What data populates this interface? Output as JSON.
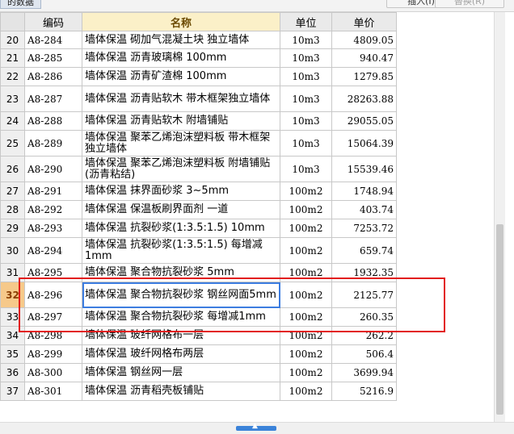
{
  "header": {
    "tab_label": "的数据",
    "btn_insert": "插入(I)",
    "btn_replace": "替换(R)"
  },
  "columns": {
    "index": "",
    "code": "编码",
    "name": "名称",
    "unit": "单位",
    "price": "单价"
  },
  "rows": [
    {
      "n": "20",
      "code": "A8-284",
      "name": "墙体保温 砌加气混凝土块 独立墙体",
      "unit": "10m3",
      "price": "4809.05"
    },
    {
      "n": "21",
      "code": "A8-285",
      "name": "墙体保温 沥青玻璃棉 100mm",
      "unit": "10m3",
      "price": "940.47"
    },
    {
      "n": "22",
      "code": "A8-286",
      "name": "墙体保温 沥青矿渣棉 100mm",
      "unit": "10m3",
      "price": "1279.85"
    },
    {
      "n": "23",
      "code": "A8-287",
      "name": "墙体保温 沥青贴软木 带木框架独立墙体",
      "unit": "10m3",
      "price": "28263.88"
    },
    {
      "n": "24",
      "code": "A8-288",
      "name": "墙体保温 沥青贴软木 附墙铺贴",
      "unit": "10m3",
      "price": "29055.05"
    },
    {
      "n": "25",
      "code": "A8-289",
      "name": "墙体保温 聚苯乙烯泡沫塑料板 带木框架独立墙体",
      "unit": "10m3",
      "price": "15064.39"
    },
    {
      "n": "26",
      "code": "A8-290",
      "name": "墙体保温 聚苯乙烯泡沫塑料板 附墙铺贴(沥青粘结)",
      "unit": "10m3",
      "price": "15539.46"
    },
    {
      "n": "27",
      "code": "A8-291",
      "name": "墙体保温 抹界面砂浆 3~5mm",
      "unit": "100m2",
      "price": "1748.94"
    },
    {
      "n": "28",
      "code": "A8-292",
      "name": "墙体保温 保温板刷界面剂 一道",
      "unit": "100m2",
      "price": "403.74"
    },
    {
      "n": "29",
      "code": "A8-293",
      "name": "墙体保温 抗裂砂浆(1:3.5:1.5) 10mm",
      "unit": "100m2",
      "price": "7253.72"
    },
    {
      "n": "30",
      "code": "A8-294",
      "name": "墙体保温 抗裂砂浆(1:3.5:1.5) 每增减1mm",
      "unit": "100m2",
      "price": "659.74"
    },
    {
      "n": "31",
      "code": "A8-295",
      "name": "墙体保温 聚合物抗裂砂浆 5mm",
      "unit": "100m2",
      "price": "1932.35"
    },
    {
      "n": "32",
      "code": "A8-296",
      "name": "墙体保温 聚合物抗裂砂浆 钢丝网面5mm",
      "unit": "100m2",
      "price": "2125.77"
    },
    {
      "n": "33",
      "code": "A8-297",
      "name": "墙体保温 聚合物抗裂砂浆 每增减1mm",
      "unit": "100m2",
      "price": "260.35"
    },
    {
      "n": "34",
      "code": "A8-298",
      "name": "墙体保温 玻纤网格布一层",
      "unit": "100m2",
      "price": "262.2"
    },
    {
      "n": "35",
      "code": "A8-299",
      "name": "墙体保温 玻纤网格布两层",
      "unit": "100m2",
      "price": "506.4"
    },
    {
      "n": "36",
      "code": "A8-300",
      "name": "墙体保温 钢丝网一层",
      "unit": "100m2",
      "price": "3699.94"
    },
    {
      "n": "37",
      "code": "A8-301",
      "name": "墙体保温 沥青稻壳板铺贴",
      "unit": "100m2",
      "price": "5216.9"
    }
  ],
  "current_row": "32",
  "scroll_up_icon": "chevron-up-icon"
}
